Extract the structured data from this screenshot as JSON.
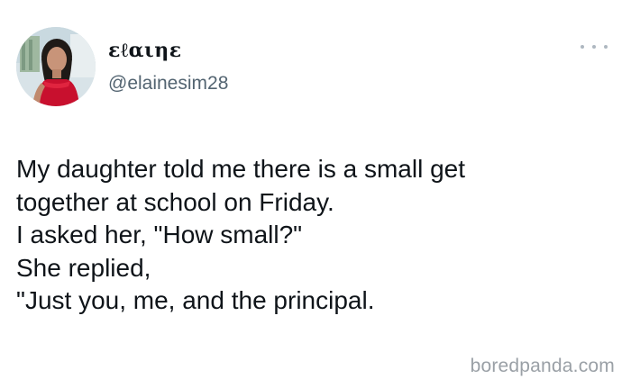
{
  "tweet": {
    "author": {
      "display_name": "ɛℓαιηɛ",
      "handle": "@elainesim28",
      "avatar_icon": "profile-photo"
    },
    "more_icon": "more-options-icon",
    "text_lines": [
      "My daughter told me there is a small get",
      "together at school on Friday.",
      "I asked her, \"How small?\"",
      "She replied,",
      "\"Just you, me, and the principal."
    ]
  },
  "watermark": "boredpanda.com",
  "colors": {
    "text": "#0f1419",
    "secondary": "#536471",
    "watermark": "#9aa0a6",
    "background": "#ffffff"
  }
}
